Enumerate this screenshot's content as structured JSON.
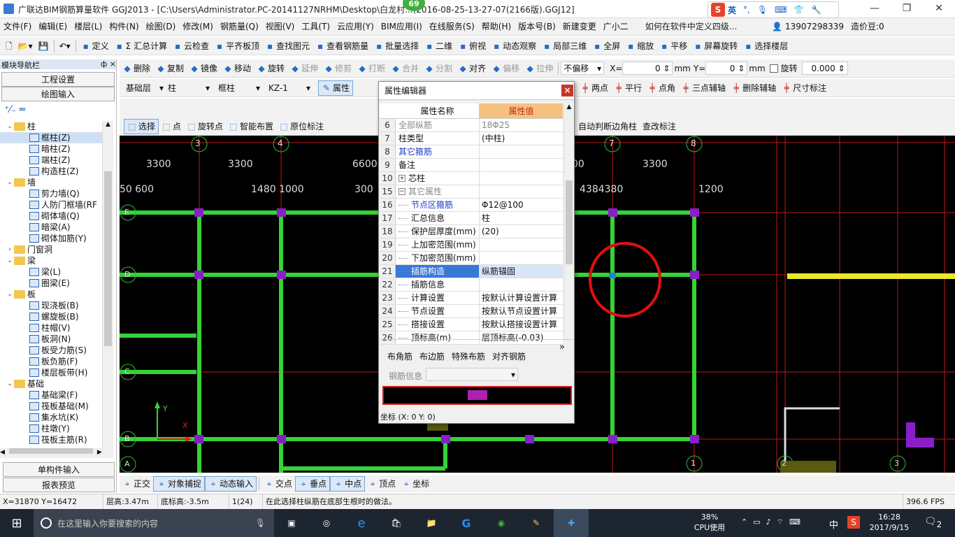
{
  "titlebar": {
    "title": "广联达BIM钢筋算量软件 GGJ2013 - [C:\\Users\\Administrator.PC-20141127NRHM\\Desktop\\白龙村...(2016-08-25-13-27-07(2166版).GGJ12]",
    "badge": "69",
    "ime": {
      "lang": "英",
      "items": [
        "·,",
        "mic",
        "kbd",
        "shirt",
        "wrench"
      ]
    }
  },
  "menubar": {
    "items": [
      "文件(F)",
      "编辑(E)",
      "楼层(L)",
      "构件(N)",
      "绘图(D)",
      "修改(M)",
      "钢筋量(Q)",
      "视图(V)",
      "工具(T)",
      "云应用(Y)",
      "BIM应用(I)",
      "在线服务(S)",
      "帮助(H)",
      "版本号(B)",
      "新建变更",
      "广小二"
    ],
    "help_question": "如何在软件中定义四级...",
    "phone": "13907298339",
    "price": "造价豆:0"
  },
  "toolbar1": {
    "items": [
      "定义",
      "Σ 汇总计算",
      "云检查",
      "平齐板顶",
      "查找图元",
      "查看钢筋量",
      "批量选择",
      "二维",
      "俯视",
      "动态观察",
      "局部三维",
      "全屏",
      "缩放",
      "平移",
      "屏幕旋转",
      "选择楼层"
    ]
  },
  "toolbar2": {
    "items": [
      "删除",
      "复制",
      "镜像",
      "移动",
      "旋转",
      "延伸",
      "修剪",
      "打断",
      "合并",
      "分割",
      "对齐",
      "偏移",
      "拉伸"
    ],
    "offset_mode": "不偏移",
    "x_label": "X=",
    "x_value": "0",
    "y_label": "Y=",
    "y_value": "0",
    "unit": "mm",
    "rotate_label": "旋转",
    "rotate_value": "0.000"
  },
  "toolbar3": {
    "floor": "基础层",
    "category": "柱",
    "type": "框柱",
    "component": "KZ-1",
    "property_btn": "属性",
    "right_items": [
      "两点",
      "平行",
      "点角",
      "三点辅轴",
      "删除辅轴",
      "尺寸标注"
    ]
  },
  "toolbar4": {
    "items": [
      "选择",
      "点",
      "旋转点",
      "智能布置",
      "原位标注"
    ],
    "right_items": [
      "自动判断边角柱",
      "查改标注"
    ]
  },
  "leftpanel": {
    "title": "模块导航栏",
    "pin": "ф ×",
    "btn_engineering": "工程设置",
    "btn_drawing": "绘图输入",
    "btn_single": "单构件输入",
    "btn_report": "报表预览",
    "tree": [
      {
        "level": 0,
        "label": "柱",
        "folder": true,
        "open": true
      },
      {
        "level": 1,
        "label": "框柱(Z)",
        "selected": true
      },
      {
        "level": 1,
        "label": "暗柱(Z)"
      },
      {
        "level": 1,
        "label": "端柱(Z)"
      },
      {
        "level": 1,
        "label": "构造柱(Z)"
      },
      {
        "level": 0,
        "label": "墙",
        "folder": true,
        "open": true
      },
      {
        "level": 1,
        "label": "剪力墙(Q)"
      },
      {
        "level": 1,
        "label": "人防门框墙(RF"
      },
      {
        "level": 1,
        "label": "砌体墙(Q)"
      },
      {
        "level": 1,
        "label": "暗梁(A)"
      },
      {
        "level": 1,
        "label": "砌体加筋(Y)"
      },
      {
        "level": 0,
        "label": "门窗洞",
        "folder": true,
        "open": false
      },
      {
        "level": 0,
        "label": "梁",
        "folder": true,
        "open": true
      },
      {
        "level": 1,
        "label": "梁(L)"
      },
      {
        "level": 1,
        "label": "圈梁(E)"
      },
      {
        "level": 0,
        "label": "板",
        "folder": true,
        "open": true
      },
      {
        "level": 1,
        "label": "现浇板(B)"
      },
      {
        "level": 1,
        "label": "螺旋板(B)"
      },
      {
        "level": 1,
        "label": "柱帽(V)"
      },
      {
        "level": 1,
        "label": "板洞(N)"
      },
      {
        "level": 1,
        "label": "板受力筋(S)"
      },
      {
        "level": 1,
        "label": "板负筋(F)"
      },
      {
        "level": 1,
        "label": "楼层板带(H)"
      },
      {
        "level": 0,
        "label": "基础",
        "folder": true,
        "open": true
      },
      {
        "level": 1,
        "label": "基础梁(F)"
      },
      {
        "level": 1,
        "label": "筏板基础(M)"
      },
      {
        "level": 1,
        "label": "集水坑(K)"
      },
      {
        "level": 1,
        "label": "柱墩(Y)"
      },
      {
        "level": 1,
        "label": "筏板主筋(R)"
      }
    ]
  },
  "canvas": {
    "axis_top": [
      "3",
      "4",
      "7",
      "8"
    ],
    "axis_left": [
      "E",
      "D",
      "C",
      "B",
      "A"
    ],
    "axis_bottom": [
      "1",
      "2",
      "3"
    ],
    "dims_row1": [
      "3300",
      "3300",
      "6600",
      "00",
      "3300"
    ],
    "dims_row2": [
      "50 600",
      "1480 1000",
      "300",
      "4384380",
      "1200"
    ],
    "ucs_x": "X",
    "ucs_y": "Y"
  },
  "dialog": {
    "title": "属性编辑器",
    "close": "×",
    "col_name": "属性名称",
    "col_value": "属性值",
    "rows": [
      {
        "n": "6",
        "k": "全部纵筋",
        "v": "18Φ25",
        "gray": true
      },
      {
        "n": "7",
        "k": "柱类型",
        "v": "(中柱)"
      },
      {
        "n": "8",
        "k": "其它箍筋",
        "v": "",
        "blue": true
      },
      {
        "n": "9",
        "k": "备注",
        "v": ""
      },
      {
        "n": "10",
        "k": "芯柱",
        "v": "",
        "expand": "+"
      },
      {
        "n": "15",
        "k": "其它属性",
        "v": "",
        "expand": "−",
        "gray": true
      },
      {
        "n": "16",
        "k": "节点区箍筋",
        "v": "Φ12@100",
        "blue": true,
        "tree": true
      },
      {
        "n": "17",
        "k": "汇总信息",
        "v": "柱",
        "tree": true
      },
      {
        "n": "18",
        "k": "保护层厚度(mm)",
        "v": "(20)",
        "tree": true
      },
      {
        "n": "19",
        "k": "上加密范围(mm)",
        "v": "",
        "tree": true
      },
      {
        "n": "20",
        "k": "下加密范围(mm)",
        "v": "",
        "tree": true
      },
      {
        "n": "21",
        "k": "插筋构造",
        "v": "纵筋锚固",
        "tree": true,
        "selected": true
      },
      {
        "n": "22",
        "k": "插筋信息",
        "v": "",
        "tree": true
      },
      {
        "n": "23",
        "k": "计算设置",
        "v": "按默认计算设置计算",
        "tree": true
      },
      {
        "n": "24",
        "k": "节点设置",
        "v": "按默认节点设置计算",
        "tree": true
      },
      {
        "n": "25",
        "k": "搭接设置",
        "v": "按默认搭接设置计算",
        "tree": true
      },
      {
        "n": "26",
        "k": "顶标高(m)",
        "v": "层顶标高(-0.03)",
        "tree": true
      }
    ],
    "tabs": [
      "布角筋",
      "布边筋",
      "特殊布筋",
      "对齐钢筋"
    ],
    "rebar_info_label": "钢筋信息",
    "coord": "坐标 (X: 0 Y: 0)"
  },
  "bottombar": {
    "items": [
      "正交",
      "对象捕捉",
      "动态输入",
      "交点",
      "垂点",
      "中点",
      "顶点",
      "坐标"
    ]
  },
  "statusbar": {
    "xy": "X=31870 Y=16472",
    "floor_height": "层高:3.47m",
    "bottom_elev": "底标高:-3.5m",
    "count": "1(24)",
    "hint": "在此选择柱纵筋在底部生根时的做法。",
    "fps": "396.6 FPS"
  },
  "taskbar": {
    "search_placeholder": "在这里输入你要搜索的内容",
    "cpu_pct": "38%",
    "cpu_label": "CPU使用",
    "lang": "中",
    "time": "16:28",
    "date": "2017/9/15",
    "notif": "2"
  }
}
